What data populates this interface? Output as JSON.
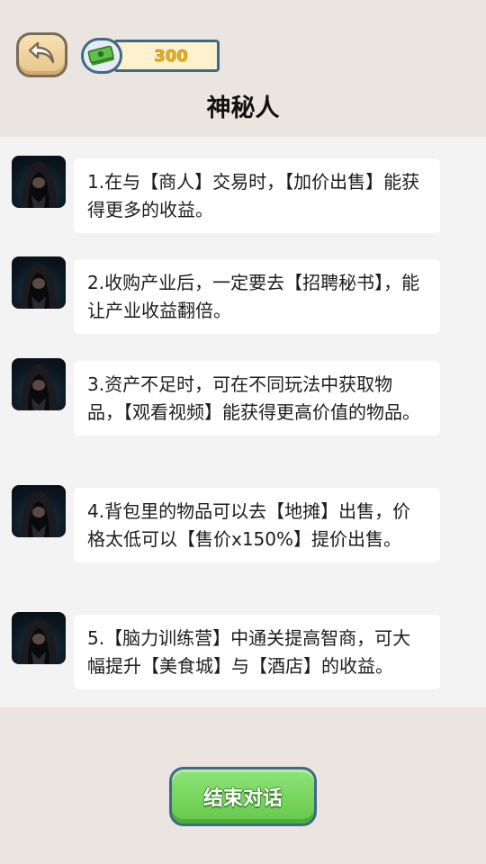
{
  "header": {
    "currency_value": "300",
    "title": "神秘人"
  },
  "icons": {
    "back": "undo-arrow-icon",
    "currency": "cash-stack-icon",
    "avatar": "hooded-figure-avatar"
  },
  "tips": [
    {
      "text": "1.在与【商人】交易时，【加价出售】能获得更多的收益。"
    },
    {
      "text": "2.收购产业后，一定要去【招聘秘书】，能让产业收益翻倍。"
    },
    {
      "text": "3.资产不足时，可在不同玩法中获取物品，【观看视频】能获得更高价值的物品。"
    },
    {
      "text": "4.背包里的物品可以去【地摊】出售，价格太低可以【售价x150%】提价出售。"
    },
    {
      "text": "5.【脑力训练营】中通关提高智商，可大幅提升【美食城】与【酒店】的收益。"
    }
  ],
  "footer": {
    "end_button_label": "结束对话"
  },
  "colors": {
    "background": "#ebe5e2",
    "panel": "#f3f3f3",
    "button_green": "#64c94a",
    "border_blue": "#3f6a86",
    "currency_gold": "#e8b51f"
  }
}
